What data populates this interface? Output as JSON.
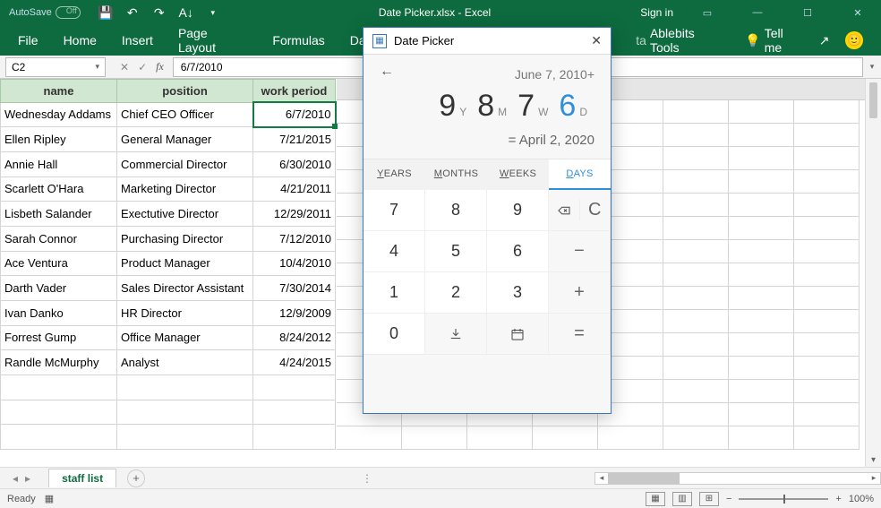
{
  "titlebar": {
    "autosave_label": "AutoSave",
    "doc_title": "Date Picker.xlsx - Excel",
    "signin": "Sign in"
  },
  "ribbon": {
    "tabs": [
      "File",
      "Home",
      "Insert",
      "Page Layout",
      "Formulas",
      "Data"
    ],
    "ablebits": "Ablebits Tools",
    "tellme": "Tell me"
  },
  "formula_bar": {
    "cell_ref": "C2",
    "value": "6/7/2010"
  },
  "table": {
    "headers": [
      "name",
      "position",
      "work period"
    ],
    "rows": [
      {
        "name": "Wednesday Addams",
        "position": "Chief CEO Officer",
        "date": "6/7/2010",
        "selected": true
      },
      {
        "name": "Ellen Ripley",
        "position": "General Manager",
        "date": "7/21/2015"
      },
      {
        "name": "Annie Hall",
        "position": "Commercial Director",
        "date": "6/30/2010"
      },
      {
        "name": "Scarlett O'Hara",
        "position": "Marketing Director",
        "date": "4/21/2011"
      },
      {
        "name": "Lisbeth Salander",
        "position": "Exectutive Director",
        "date": "12/29/2011"
      },
      {
        "name": "Sarah Connor",
        "position": "Purchasing Director",
        "date": "7/12/2010"
      },
      {
        "name": "Ace Ventura",
        "position": "Product Manager",
        "date": "10/4/2010"
      },
      {
        "name": "Darth Vader",
        "position": "Sales Director Assistant",
        "date": "7/30/2014"
      },
      {
        "name": "Ivan Danko",
        "position": "HR Director",
        "date": "12/9/2009"
      },
      {
        "name": "Forrest Gump",
        "position": "Office Manager",
        "date": "8/24/2012"
      },
      {
        "name": "Randle McMurphy",
        "position": "Analyst",
        "date": "4/24/2015"
      }
    ]
  },
  "sheets": {
    "active": "staff list"
  },
  "status": {
    "ready": "Ready",
    "zoom": "100%"
  },
  "picker": {
    "title": "Date Picker",
    "base_date": "June 7, 2010+",
    "components": [
      {
        "n": "9",
        "u": "Y"
      },
      {
        "n": "8",
        "u": "M"
      },
      {
        "n": "7",
        "u": "W"
      },
      {
        "n": "6",
        "u": "D",
        "active": true
      }
    ],
    "result": "= April 2, 2020",
    "tabs": [
      {
        "pre": "Y",
        "rest": "EARS"
      },
      {
        "pre": "M",
        "rest": "ONTHS"
      },
      {
        "pre": "W",
        "rest": "EEKS"
      },
      {
        "pre": "D",
        "rest": "AYS",
        "active": true
      }
    ],
    "keys": [
      {
        "t": "7"
      },
      {
        "t": "8"
      },
      {
        "t": "9"
      },
      {
        "t": "bksp",
        "op": true
      },
      {
        "t": "4"
      },
      {
        "t": "5"
      },
      {
        "t": "6"
      },
      {
        "t": "−",
        "op": true
      },
      {
        "t": "1"
      },
      {
        "t": "2"
      },
      {
        "t": "3"
      },
      {
        "t": "+",
        "op": true
      },
      {
        "t": "0"
      },
      {
        "t": "insert",
        "op": true
      },
      {
        "t": "cal",
        "op": true
      },
      {
        "t": "=",
        "op": true
      }
    ],
    "clear": "C"
  }
}
